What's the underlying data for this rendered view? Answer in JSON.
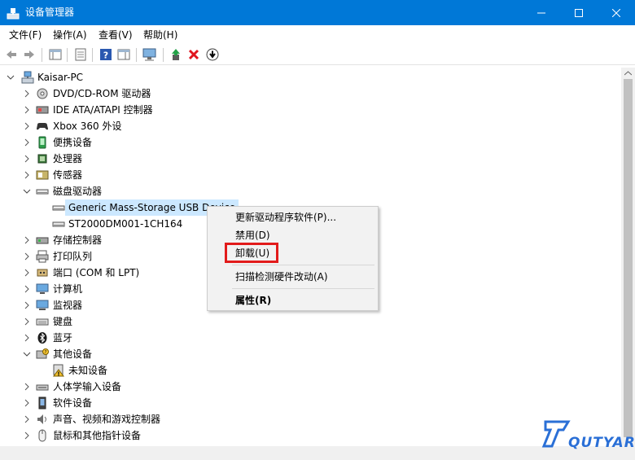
{
  "window": {
    "title": "设备管理器"
  },
  "menu": [
    "文件(F)",
    "操作(A)",
    "查看(V)",
    "帮助(H)"
  ],
  "tree": {
    "root": "Kaisar-PC",
    "items": [
      {
        "label": "DVD/CD-ROM 驱动器",
        "expanded": false,
        "icon": "dvd-drive-icon"
      },
      {
        "label": "IDE ATA/ATAPI 控制器",
        "expanded": false,
        "icon": "ide-controller-icon"
      },
      {
        "label": "Xbox 360 外设",
        "expanded": false,
        "icon": "gamepad-icon"
      },
      {
        "label": "便携设备",
        "expanded": false,
        "icon": "portable-device-icon"
      },
      {
        "label": "处理器",
        "expanded": false,
        "icon": "processor-icon"
      },
      {
        "label": "传感器",
        "expanded": false,
        "icon": "sensor-icon"
      },
      {
        "label": "磁盘驱动器",
        "expanded": true,
        "icon": "disk-drive-icon",
        "children": [
          {
            "label": "Generic Mass-Storage USB Device",
            "selected": true,
            "icon": "disk-drive-icon"
          },
          {
            "label": "ST2000DM001-1CH164",
            "icon": "disk-drive-icon"
          }
        ]
      },
      {
        "label": "存储控制器",
        "expanded": false,
        "icon": "storage-controller-icon"
      },
      {
        "label": "打印队列",
        "expanded": false,
        "icon": "printer-icon"
      },
      {
        "label": "端口 (COM 和 LPT)",
        "expanded": false,
        "icon": "port-icon"
      },
      {
        "label": "计算机",
        "expanded": false,
        "icon": "computer-icon"
      },
      {
        "label": "监视器",
        "expanded": false,
        "icon": "monitor-icon"
      },
      {
        "label": "键盘",
        "expanded": false,
        "icon": "keyboard-icon"
      },
      {
        "label": "蓝牙",
        "expanded": false,
        "icon": "bluetooth-icon"
      },
      {
        "label": "其他设备",
        "expanded": true,
        "icon": "other-devices-icon",
        "children": [
          {
            "label": "未知设备",
            "icon": "unknown-device-warning-icon"
          }
        ]
      },
      {
        "label": "人体学输入设备",
        "expanded": false,
        "icon": "hid-icon"
      },
      {
        "label": "软件设备",
        "expanded": false,
        "icon": "software-device-icon"
      },
      {
        "label": "声音、视频和游戏控制器",
        "expanded": false,
        "icon": "sound-icon"
      },
      {
        "label": "鼠标和其他指针设备",
        "expanded": false,
        "icon": "mouse-icon"
      }
    ]
  },
  "context_menu": [
    "更新驱动程序软件(P)...",
    "禁用(D)",
    "卸载(U)",
    "扫描检测硬件改动(A)",
    "属性(R)"
  ],
  "watermark": {
    "text": "QUTYAR"
  },
  "colors": {
    "titlebar": "#0078d7",
    "selection": "#cce8ff",
    "highlight_box": "#e21b1b"
  }
}
